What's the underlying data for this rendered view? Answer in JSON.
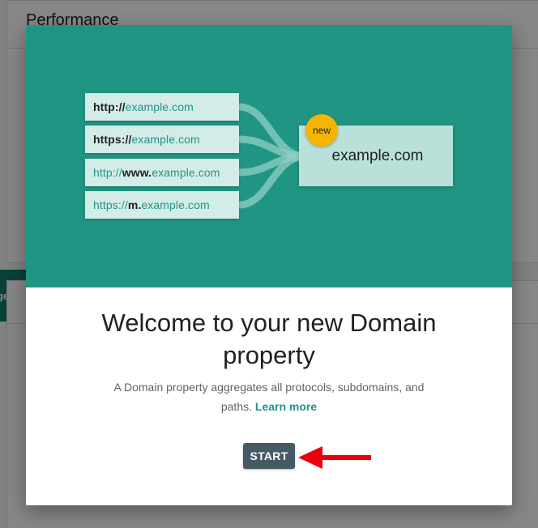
{
  "background": {
    "section_title": "Performance",
    "pill_text": "ges p"
  },
  "dialog": {
    "illustration": {
      "urls": [
        {
          "parts": [
            {
              "text": "http://",
              "style": "dark"
            },
            {
              "text": "example.com",
              "style": "teal"
            }
          ]
        },
        {
          "parts": [
            {
              "text": "https://",
              "style": "dark"
            },
            {
              "text": "example.com",
              "style": "teal"
            }
          ]
        },
        {
          "parts": [
            {
              "text": "http://",
              "style": "teal"
            },
            {
              "text": "www.",
              "style": "dark"
            },
            {
              "text": "example.com",
              "style": "teal"
            }
          ]
        },
        {
          "parts": [
            {
              "text": "https://",
              "style": "teal"
            },
            {
              "text": "m.",
              "style": "dark"
            },
            {
              "text": "example.com",
              "style": "teal"
            }
          ]
        }
      ],
      "badge": "new",
      "domain": "example.com"
    },
    "heading": "Welcome to your new Domain property",
    "description": "A Domain property aggregates all protocols, subdomains, and paths.",
    "learn_more": "Learn more",
    "start_label": "START"
  },
  "colors": {
    "hero": "#219584",
    "accent": "#219584",
    "button": "#455a64",
    "badge": "#f5b400",
    "arrow": "#e8000b"
  }
}
